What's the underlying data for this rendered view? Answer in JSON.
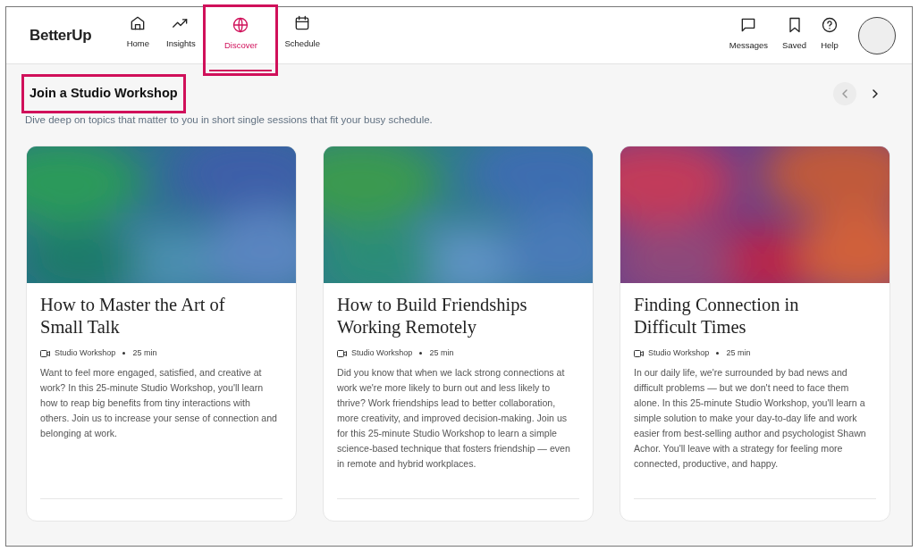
{
  "brand": "BetterUp",
  "nav_tabs": [
    {
      "label": "Home",
      "kind": "home",
      "selected": false,
      "highlighted": false
    },
    {
      "label": "Insights",
      "kind": "trend",
      "selected": false,
      "highlighted": false
    },
    {
      "label": "Discover",
      "kind": "globe",
      "selected": true,
      "highlighted": true
    },
    {
      "label": "Schedule",
      "kind": "calendar",
      "selected": false,
      "highlighted": false
    }
  ],
  "nav_actions": [
    {
      "label": "Messages",
      "kind": "message"
    },
    {
      "label": "Saved",
      "kind": "bookmark"
    },
    {
      "label": "Help",
      "kind": "help"
    }
  ],
  "section": {
    "title": "Join a Studio Workshop",
    "highlighted": true,
    "subtitle": "Dive deep on topics that matter to you in short single sessions that fit your busy schedule.",
    "prev_disabled": true,
    "next_disabled": false
  },
  "cards": [
    {
      "title": "How to Master the Art of Small Talk",
      "type": "Studio Workshop",
      "duration": "25 min",
      "description": "Want to feel more engaged, satisfied, and creative at work? In this 25-minute Studio Workshop, you'll learn how to reap big benefits from tiny interactions with others. Join us to increase your sense of connection and belonging at work."
    },
    {
      "title": "How to Build Friendships Working Remotely",
      "type": "Studio Workshop",
      "duration": "25 min",
      "description": "Did you know that when we lack strong connections at work we're more likely to burn out and less likely to thrive? Work friendships lead to better collaboration, more creativity, and improved decision-making. Join us for this 25-minute Studio Workshop to learn a simple science-based technique that fosters friendship — even in remote and hybrid workplaces."
    },
    {
      "title": "Finding Connection in Difficult Times",
      "type": "Studio Workshop",
      "duration": "25 min",
      "description": "In our daily life, we're surrounded by bad news and difficult problems — but we don't need to face them alone. In this 25-minute Studio Workshop, you'll learn a simple solution to make your day-to-day life and work easier from best-selling author and psychologist Shawn Achor. You'll leave with a strategy for feeling more connected, productive, and happy."
    }
  ]
}
